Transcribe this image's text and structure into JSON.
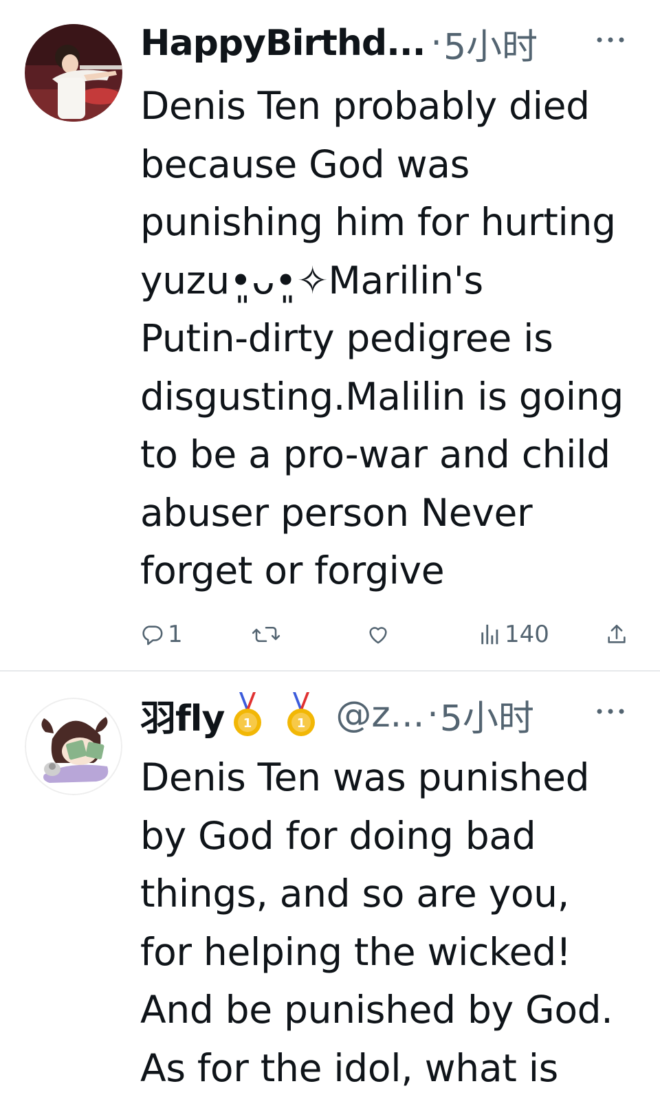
{
  "tweets": [
    {
      "display_name": "HappyBirthd...",
      "handle": "",
      "separator": "·",
      "time": "5小时",
      "more_icon": "ellipsis-icon",
      "text_lines": [
        "Denis Ten probably died",
        "because God was",
        "punishing him for hurting",
        "yuzu•͈ᴗ•͈✧Marilin's",
        "Putin-dirty pedigree is",
        "disgusting.Malilin is going",
        "to be a pro-war and child",
        "abuser person Never",
        "forget or forgive"
      ],
      "actions": {
        "reply_count": "1",
        "retweet_count": "",
        "like_count": "",
        "views_count": "140"
      }
    },
    {
      "display_name": "羽fly",
      "handle": "@z...",
      "separator": "·",
      "time": "5小时",
      "badges": [
        "medal-icon",
        "medal-icon"
      ],
      "more_icon": "ellipsis-icon",
      "text_lines": [
        "Denis Ten was punished",
        "by God for doing bad",
        "things, and so are you,",
        "for helping the wicked!",
        "And be punished by God.",
        "As for the idol, what is"
      ]
    }
  ],
  "colors": {
    "text": "#0f1419",
    "secondary": "#536471",
    "divider": "#e6e9eb"
  }
}
